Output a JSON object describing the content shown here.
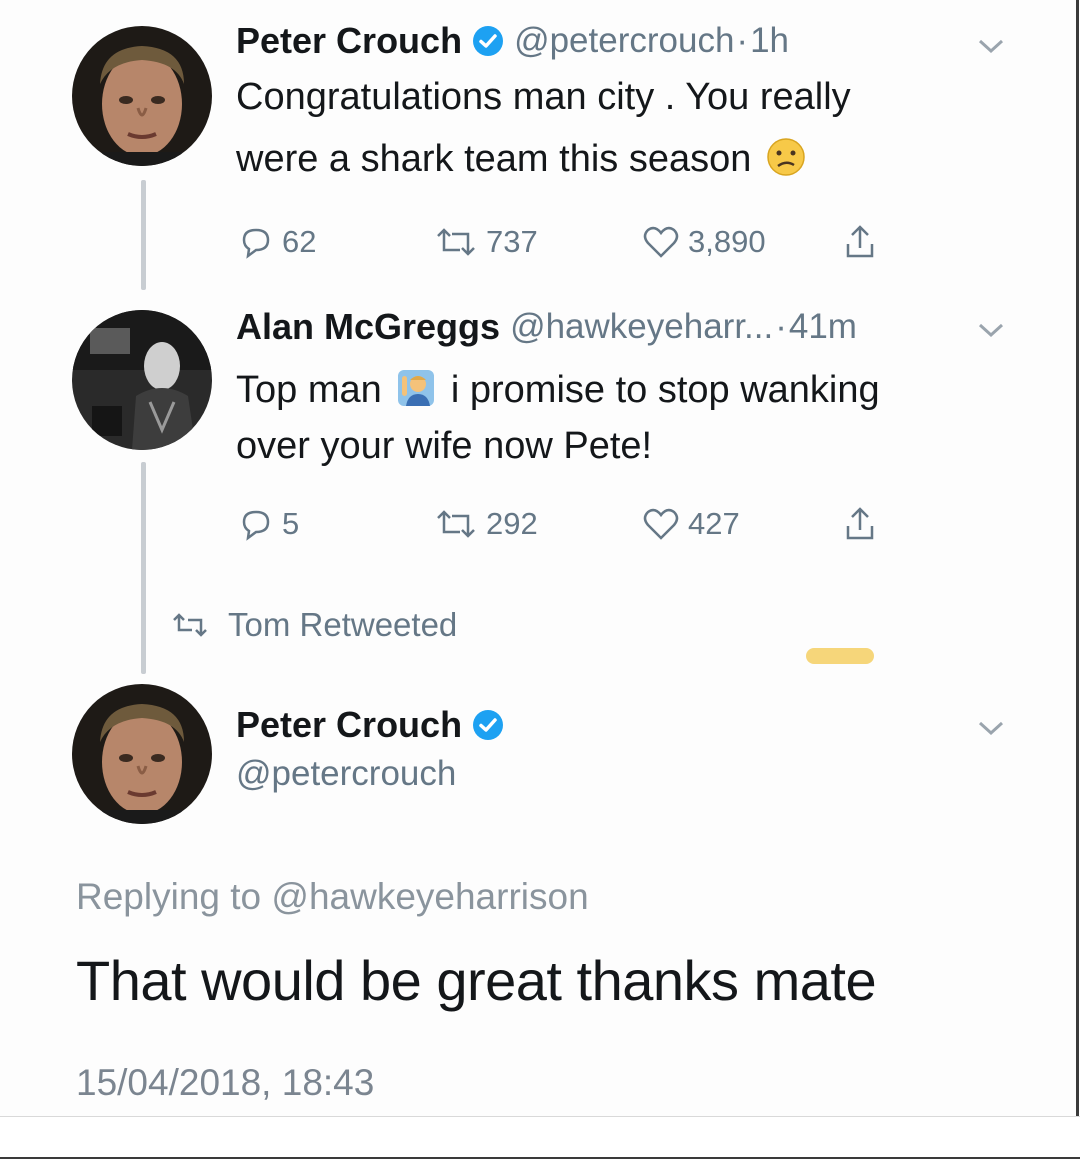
{
  "tweet1": {
    "name": "Peter Crouch",
    "handle": "@petercrouch",
    "time": "1h",
    "text_line1": "Congratulations man city . You really",
    "text_line2": "were a shark team this season",
    "emoji": "confused-face-emoji",
    "replies": "62",
    "retweets": "737",
    "likes": "3,890"
  },
  "tweet2": {
    "name": "Alan McGreggs",
    "handle": "@hawkeyeharr...",
    "time": "41m",
    "text_before_emoji": "Top man",
    "text_after_emoji": "i promise to stop wanking",
    "text_line2": "over your wife now Pete!",
    "emoji": "man-raising-hand-emoji",
    "replies": "5",
    "retweets": "292",
    "likes": "427"
  },
  "retweet_notice": "Tom Retweeted",
  "tweet3": {
    "name": "Peter Crouch",
    "handle": "@petercrouch",
    "replying_prefix": "Replying to",
    "replying_to": "@hawkeyeharrison",
    "text": "That would be great thanks mate",
    "timestamp": "15/04/2018, 18:43"
  },
  "colors": {
    "verified": "#1da1f2",
    "secondary_text": "#657786",
    "primary_text": "#14171a",
    "thread_line": "#c8cdd2",
    "highlight": "#f6d67a"
  }
}
